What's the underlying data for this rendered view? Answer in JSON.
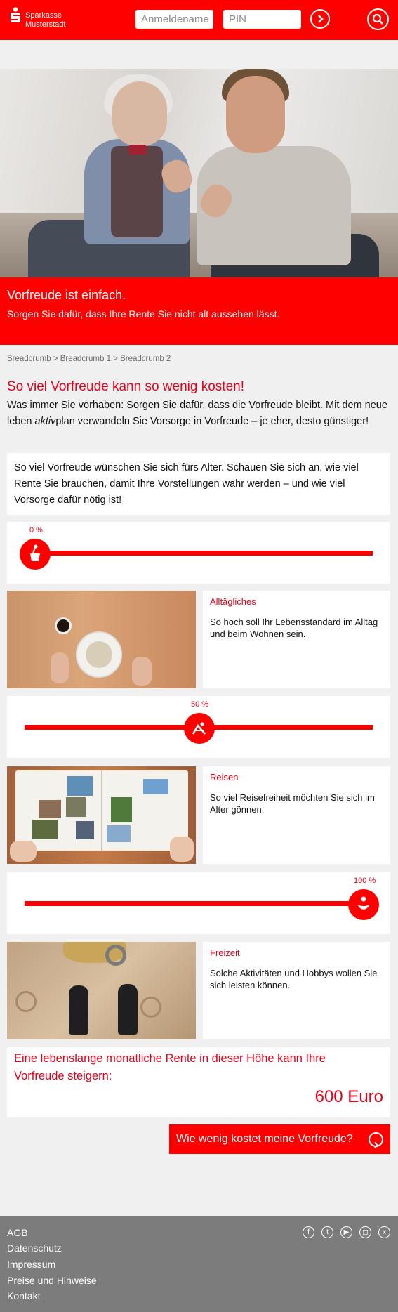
{
  "header": {
    "brand_line1": "Sparkasse",
    "brand_line2": "Musterstadt",
    "username_placeholder": "Anmeldename",
    "pin_placeholder": "PIN"
  },
  "hero": {
    "title": "Vorfreude ist einfach.",
    "subtitle": "Sorgen Sie dafür, dass Ihre Rente Sie nicht alt aussehen lässt."
  },
  "breadcrumb": "Breadcrumb > Breadcrumb 1 > Breadcrumb 2",
  "intro": {
    "heading": "So viel Vorfreude kann so wenig kosten!",
    "text_before": "Was immer Sie vorhaben: Sorgen Sie dafür, dass die Vorfreude bleibt. Mit dem neue leben ",
    "text_italic": "aktiv",
    "text_after": "plan verwandeln Sie Vorsorge in Vorfreude – je eher, desto günstiger!"
  },
  "info_box": "So viel Vorfreude wünschen Sie sich fürs Alter. Schauen Sie sich an, wie viel Rente Sie brauchen, damit Ihre Vorstellungen wahr werden – und wie viel Vorsorge dafür nötig ist!",
  "sliders": [
    {
      "label": "0 %",
      "value": 0,
      "icon": "bucket-icon"
    },
    {
      "label": "50 %",
      "value": 50,
      "icon": "deck-chair-icon"
    },
    {
      "label": "100 %",
      "value": 100,
      "icon": "person-icon"
    }
  ],
  "categories": [
    {
      "title": "Alltägliches",
      "text": "So hoch soll Ihr Lebensstandard im Alltag und beim Wohnen sein."
    },
    {
      "title": "Reisen",
      "text": "So viel Reisefreiheit möchten Sie sich im Alter gönnen."
    },
    {
      "title": "Freizeit",
      "text": "Solche Aktivitäten und Hobbys wollen Sie sich leisten können."
    }
  ],
  "result": {
    "text": "Eine lebenslange monatliche Rente in dieser Höhe kann Ihre Vorfreude steigern:",
    "value": "600 Euro"
  },
  "cta_label": "Wie wenig kostet meine Vorfreude?",
  "footer": {
    "links": [
      "AGB",
      "Datenschutz",
      "Impressum",
      "Preise und Hinweise",
      "Kontakt"
    ],
    "social": [
      "facebook-icon",
      "twitter-icon",
      "youtube-icon",
      "instagram-icon",
      "xing-icon"
    ]
  },
  "colors": {
    "brand_red": "#ff0000",
    "text_red": "#e2001a",
    "footer_grey": "#7c7c7c"
  }
}
